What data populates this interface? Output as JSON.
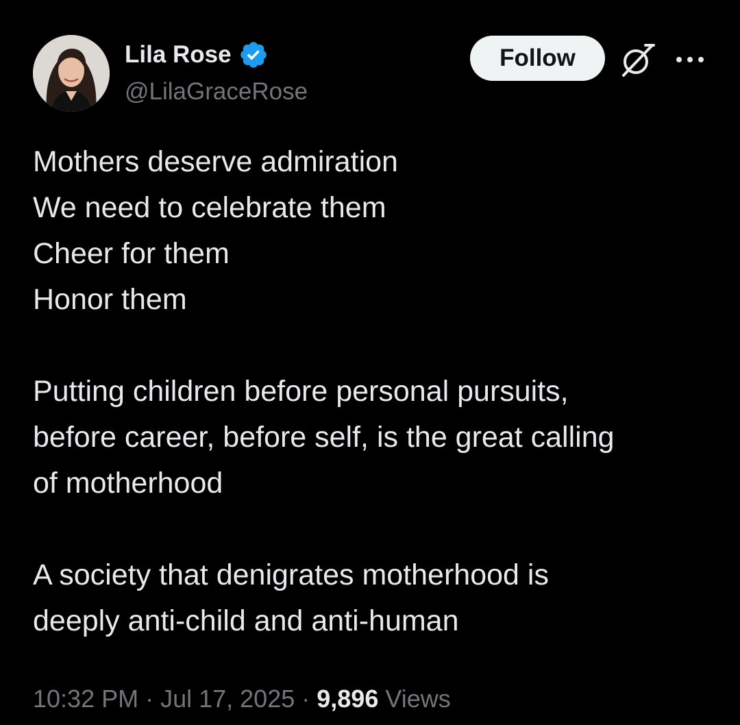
{
  "author": {
    "display_name": "Lila Rose",
    "handle": "@LilaGraceRose",
    "verified": true,
    "avatar_icon": "profile-photo"
  },
  "actions": {
    "follow_label": "Follow",
    "grok_icon": "grok-icon",
    "more_icon": "more-dots-icon"
  },
  "tweet": {
    "paragraphs": [
      [
        "Mothers deserve admiration",
        "We need to celebrate them",
        "Cheer for them",
        "Honor them"
      ],
      [
        "Putting children before personal pursuits,",
        "before career, before self, is the great calling",
        "of motherhood"
      ],
      [
        "A society that denigrates motherhood is",
        "deeply anti-child and anti-human"
      ]
    ]
  },
  "meta": {
    "time": "10:32 PM",
    "separator": " · ",
    "date": "Jul 17, 2025",
    "views_count": "9,896",
    "views_label": " Views"
  },
  "colors": {
    "background": "#000000",
    "primary_text": "#e7e9ea",
    "secondary_text": "#71767b",
    "verified_badge": "#1d9bf0",
    "follow_button_bg": "#eff3f4",
    "follow_button_text": "#0f1419"
  }
}
